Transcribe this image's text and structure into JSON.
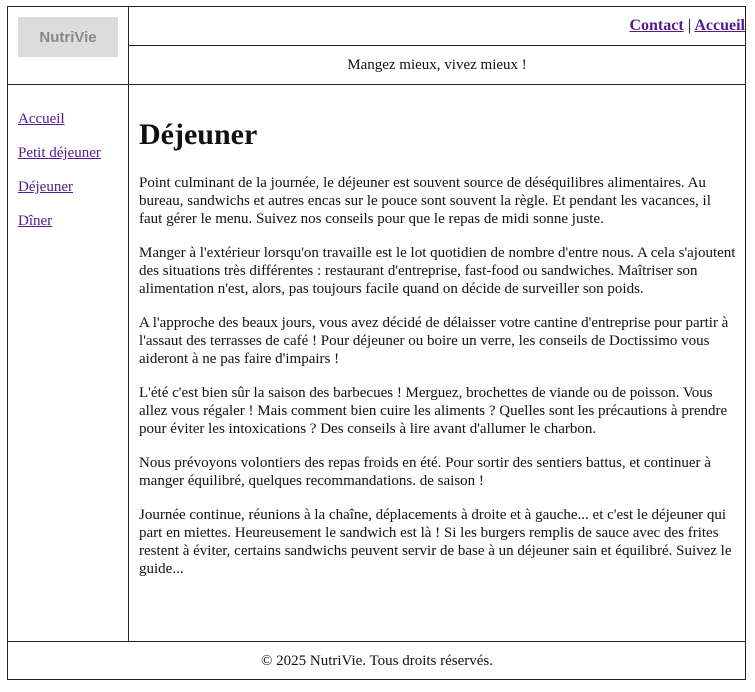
{
  "header": {
    "logo": "NutriVie",
    "nav": [
      {
        "label": "Contact"
      },
      {
        "label": "Accueil"
      }
    ],
    "nav_separator": "|",
    "tagline": "Mangez mieux, vivez mieux !"
  },
  "sidebar": {
    "items": [
      {
        "label": "Accueil"
      },
      {
        "label": "Petit déjeuner"
      },
      {
        "label": "Déjeuner"
      },
      {
        "label": "Dîner"
      }
    ]
  },
  "main": {
    "title": "Déjeuner",
    "paragraphs": [
      "Point culminant de la journée, le déjeuner est souvent source de déséquilibres alimentaires. Au bureau, sandwichs et autres encas sur le pouce sont souvent la règle. Et pendant les vacances, il faut gérer le menu. Suivez nos conseils pour que le repas de midi sonne juste.",
      "Manger à l'extérieur lorsqu'on travaille est le lot quotidien de nombre d'entre nous. A cela s'ajoutent des situations très différentes : restaurant d'entreprise, fast-food ou sandwiches. Maîtriser son alimentation n'est, alors, pas toujours facile quand on décide de surveiller son poids.",
      "A l'approche des beaux jours, vous avez décidé de délaisser votre cantine d'entreprise pour partir à l'assaut des terrasses de café ! Pour déjeuner ou boire un verre, les conseils de Doctissimo vous aideront à ne pas faire d'impairs !",
      "L'été c'est bien sûr la saison des barbecues ! Merguez, brochettes de viande ou de poisson. Vous allez vous régaler ! Mais comment bien cuire les aliments ? Quelles sont les précautions à prendre pour éviter les intoxications ? Des conseils à lire avant d'allumer le charbon.",
      "Nous prévoyons volontiers des repas froids en été. Pour sortir des sentiers battus, et continuer à manger équilibré, quelques recommandations. de saison !",
      "Journée continue, réunions à la chaîne, déplacements à droite et à gauche... et c'est le déjeuner qui part en miettes. Heureusement le sandwich est là ! Si les burgers remplis de sauce avec des frites restent à éviter, certains sandwichs peuvent servir de base à un déjeuner sain et équilibré. Suivez le guide..."
    ]
  },
  "footer": {
    "text": "© 2025 NutriVie. Tous droits réservés."
  }
}
